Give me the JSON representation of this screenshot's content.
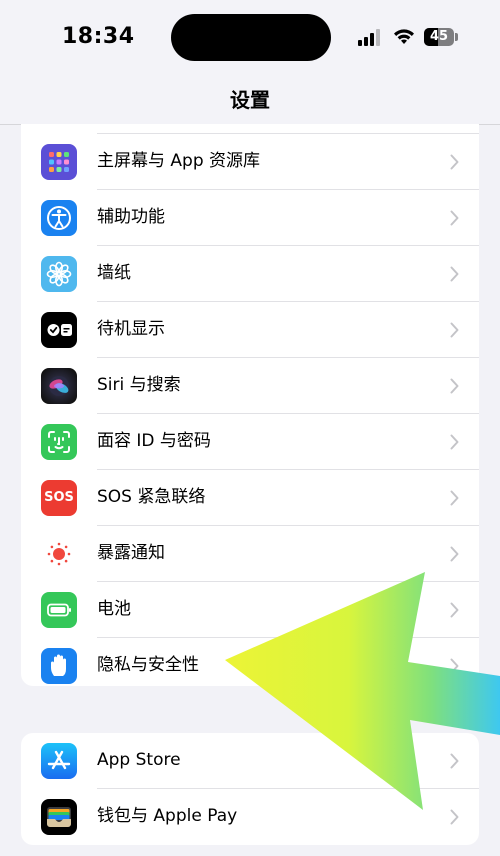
{
  "status_bar": {
    "time": "18:34",
    "battery_percent": "45",
    "battery_level": 0.45
  },
  "nav": {
    "title": "设置"
  },
  "group1": {
    "items": [
      {
        "label": "主屏幕与 App 资源库",
        "icon": "home-screen-grid-icon"
      },
      {
        "label": "辅助功能",
        "icon": "accessibility-icon"
      },
      {
        "label": "墙纸",
        "icon": "wallpaper-flower-icon"
      },
      {
        "label": "待机显示",
        "icon": "standby-icon"
      },
      {
        "label": "Siri 与搜索",
        "icon": "siri-icon"
      },
      {
        "label": "面容 ID 与密码",
        "icon": "face-id-icon"
      },
      {
        "label": "SOS 紧急联络",
        "icon": "sos-icon",
        "icon_text": "SOS"
      },
      {
        "label": "暴露通知",
        "icon": "exposure-notification-icon"
      },
      {
        "label": "电池",
        "icon": "battery-icon"
      },
      {
        "label": "隐私与安全性",
        "icon": "privacy-hand-icon"
      }
    ]
  },
  "group2": {
    "items": [
      {
        "label": "App Store",
        "icon": "app-store-icon"
      },
      {
        "label": "钱包与 Apple Pay",
        "icon": "wallet-icon"
      }
    ]
  },
  "colors": {
    "home_screen": "#5b4fd6",
    "accessibility": "#1a82f0",
    "wallpaper": "#4fb8ee",
    "standby": "#000000",
    "face_id": "#34c759",
    "sos": "#ec3b31",
    "exposure": "#ffffff",
    "battery": "#34c759",
    "privacy": "#1a82f0",
    "app_store": "#1d8bf1",
    "wallet": "#000000",
    "arrow_start": "#ecf436",
    "arrow_end": "#3ec8f0"
  }
}
